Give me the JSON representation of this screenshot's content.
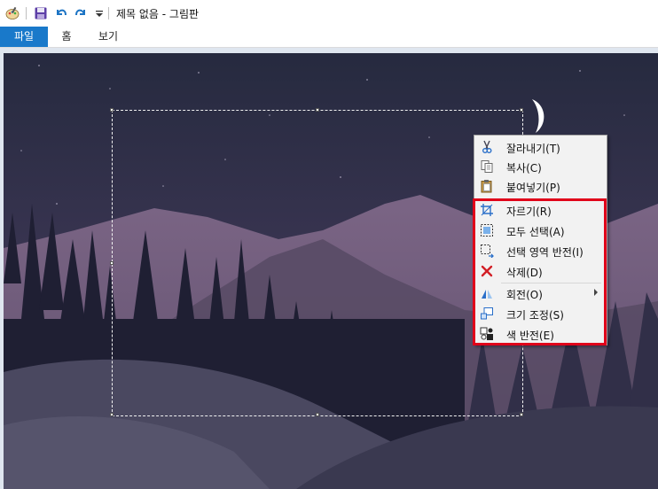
{
  "window": {
    "title": "제목 없음 - 그림판"
  },
  "quick_access": {
    "icons": [
      "paint-app-icon",
      "save-icon",
      "undo-icon",
      "redo-icon",
      "customize-dropdown-icon"
    ]
  },
  "ribbon": {
    "tabs": [
      {
        "label": "파일",
        "active": true
      },
      {
        "label": "홈",
        "active": false
      },
      {
        "label": "보기",
        "active": false
      }
    ],
    "accent": "#1979ca"
  },
  "canvas": {
    "scene": "night mountain landscape",
    "colors": {
      "sky": "#2f2f47",
      "far_mountain": "#6d5b7a",
      "trees": "#1f1f33",
      "hill": "#4a4860",
      "moon": "#ffffff"
    }
  },
  "context_menu": {
    "items": [
      {
        "label": "잘라내기(T)",
        "icon": "scissors-icon"
      },
      {
        "label": "복사(C)",
        "icon": "copy-icon"
      },
      {
        "label": "붙여넣기(P)",
        "icon": "paste-icon"
      },
      {
        "label": "자르기(R)",
        "icon": "crop-icon"
      },
      {
        "label": "모두 선택(A)",
        "icon": "select-all-icon"
      },
      {
        "label": "선택 영역 반전(I)",
        "icon": "invert-selection-icon"
      },
      {
        "label": "삭제(D)",
        "icon": "delete-icon"
      },
      {
        "label": "회전(O)",
        "icon": "rotate-icon",
        "submenu": true
      },
      {
        "label": "크기 조정(S)",
        "icon": "resize-icon"
      },
      {
        "label": "색 반전(E)",
        "icon": "invert-color-icon"
      }
    ],
    "highlight_color": "#e0001a"
  }
}
